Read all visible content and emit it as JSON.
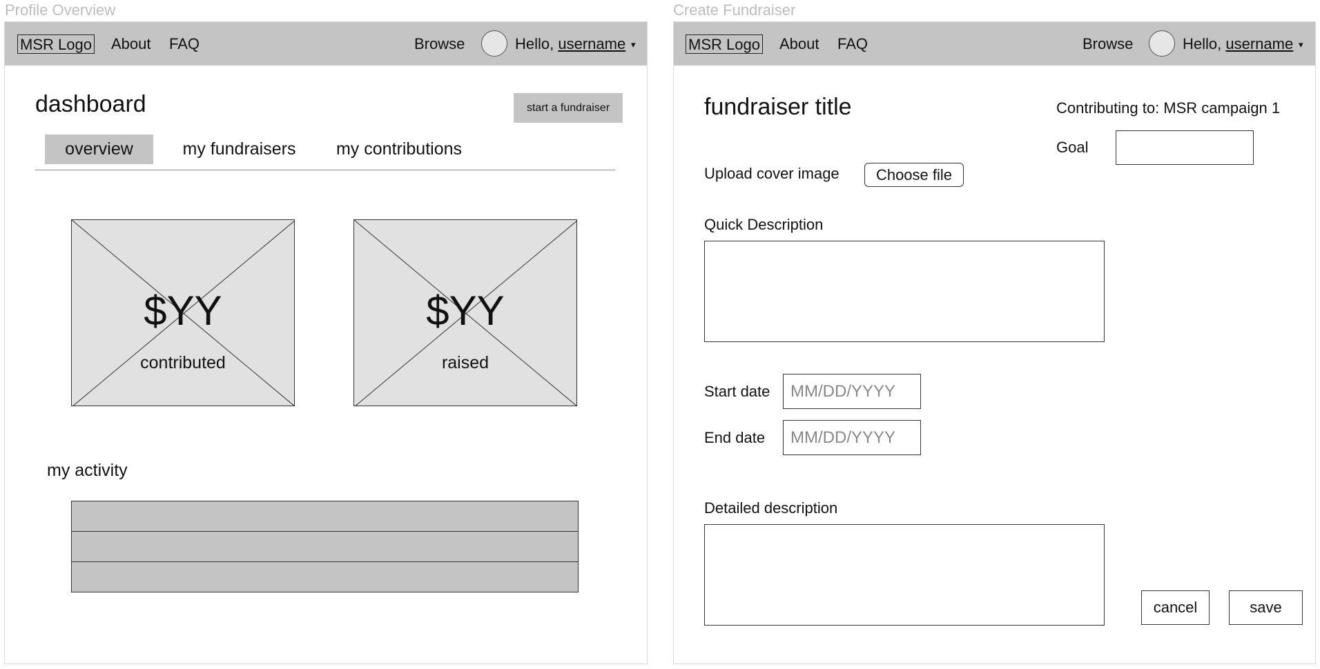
{
  "profile_frame": {
    "caption": "Profile Overview",
    "navbar": {
      "logo": "MSR Logo",
      "links": [
        "About",
        "FAQ"
      ],
      "browse": "Browse",
      "greeting": "Hello,",
      "username": "username",
      "caret": "▾"
    },
    "title": "dashboard",
    "start_button": "start a fundraiser",
    "tabs": [
      {
        "label": "overview",
        "active": true
      },
      {
        "label": "my fundraisers",
        "active": false
      },
      {
        "label": "my contributions",
        "active": false
      }
    ],
    "stats": [
      {
        "value": "$YY",
        "label": "contributed"
      },
      {
        "value": "$YY",
        "label": "raised"
      }
    ],
    "activity_title": "my activity",
    "activity_rows": 3
  },
  "create_frame": {
    "caption": "Create Fundraiser",
    "navbar": {
      "logo": "MSR Logo",
      "links": [
        "About",
        "FAQ"
      ],
      "browse": "Browse",
      "greeting": "Hello,",
      "username": "username",
      "caret": "▾"
    },
    "title": "fundraiser title",
    "contributing_to": "Contributing to: MSR campaign 1",
    "goal_label": "Goal",
    "goal_value": "",
    "upload_label": "Upload cover image",
    "choose_file": "Choose file",
    "quick_description_label": "Quick Description",
    "start_date_label": "Start date",
    "start_date_placeholder": "MM/DD/YYYY",
    "end_date_label": "End date",
    "end_date_placeholder": "MM/DD/YYYY",
    "detailed_description_label": "Detailed description",
    "cancel": "cancel",
    "save": "save"
  },
  "colors": {
    "navbar": "#c4c4c4",
    "placeholder_box": "#e1e1e1",
    "frame_border": "#dadada",
    "caption": "#bdbdbd"
  }
}
